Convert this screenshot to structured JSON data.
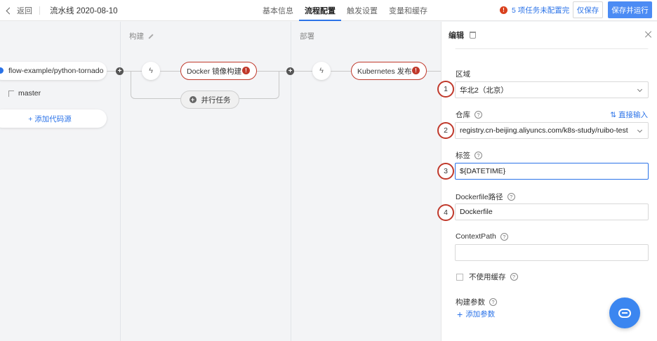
{
  "topbar": {
    "back_label": "返回",
    "pipeline_title": "流水线 2020-08-10",
    "tabs": [
      {
        "label": "基本信息"
      },
      {
        "label": "流程配置",
        "active": true
      },
      {
        "label": "触发设置"
      },
      {
        "label": "变量和缓存"
      }
    ],
    "warning_text": "5 项任务未配置完",
    "warning_icon": "!",
    "save_label": "仅保存",
    "save_run_label": "保存并运行"
  },
  "canvas": {
    "stages": [
      {
        "title": "构建"
      },
      {
        "title": "部署"
      }
    ],
    "source": {
      "repo": "flow-example/python-tornado",
      "branch": "master",
      "add_source_label": "+ 添加代码源"
    },
    "tasks": [
      {
        "name": "Docker 镜像构建",
        "trigger_icon": "ϟ",
        "error_icon": "!"
      },
      {
        "name": "Kubernetes 发布",
        "trigger_icon": "ϟ",
        "error_icon": "!"
      }
    ],
    "parallel_label": "并行任务",
    "parallel_icon": "+",
    "plus_icon": "+"
  },
  "panel": {
    "title": "编辑",
    "fields": {
      "region": {
        "label": "区域",
        "value": "华北2（北京）"
      },
      "repository": {
        "label": "仓库",
        "value": "registry.cn-beijing.aliyuncs.com/k8s-study/ruibo-test",
        "direct_input": "⇅ 直接输入"
      },
      "tag": {
        "label": "标签",
        "value": "${DATETIME}"
      },
      "dockerfile": {
        "label": "Dockerfile路径",
        "value": "Dockerfile"
      },
      "context_path": {
        "label": "ContextPath",
        "value": ""
      },
      "no_cache": {
        "label": "不使用缓存"
      },
      "build_args": {
        "label": "构建参数",
        "add_label": "添加参数",
        "add_icon": "+"
      }
    },
    "help_icon": "?",
    "markers": [
      "1",
      "2",
      "3",
      "4"
    ]
  },
  "colors": {
    "accent": "#2b73e8",
    "error": "#c0392b",
    "primary_button": "#4b8bf4"
  },
  "icons": {
    "chat": "chat-bubble-icon"
  }
}
